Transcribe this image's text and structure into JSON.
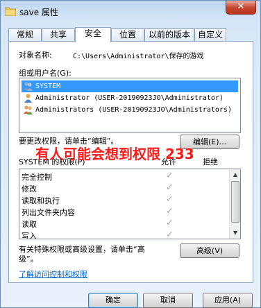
{
  "window": {
    "title": "save 属性",
    "close_label": "✕"
  },
  "tabs": [
    {
      "label": "常规"
    },
    {
      "label": "共享"
    },
    {
      "label": "安全"
    },
    {
      "label": "位置"
    },
    {
      "label": "以前的版本"
    },
    {
      "label": "自定义"
    }
  ],
  "security": {
    "object_name_label": "对象名称:",
    "object_name_value": "C:\\Users\\Administrator\\保存的游戏",
    "group_label": "组或用户名(G):",
    "users": [
      {
        "name": "SYSTEM"
      },
      {
        "name": "Administrator (USER-20190923JO\\Administrator)"
      },
      {
        "name": "Administrators (USER-20190923JO\\Administrators)"
      }
    ],
    "change_perm_text": "要更改权限，请单击“编辑”。",
    "edit_button": "编辑(E)...",
    "perm_header": "SYSTEM 的权限(P)",
    "allow_header": "允许",
    "deny_header": "拒绝",
    "permissions": [
      {
        "name": "完全控制",
        "allow": "✓"
      },
      {
        "name": "修改",
        "allow": "✓"
      },
      {
        "name": "读取和执行",
        "allow": "✓"
      },
      {
        "name": "列出文件夹内容",
        "allow": "✓"
      },
      {
        "name": "读取",
        "allow": "✓"
      },
      {
        "name": "写入",
        "allow": "✓"
      }
    ],
    "advanced_text_1": "有关特殊权限或高级设置，请单击“高",
    "advanced_text_2": "级”。",
    "advanced_button": "高级(V)",
    "learn_link": "了解访问控制和权限"
  },
  "overlay_text": "有人可能会想到权限 233",
  "footer": {
    "ok": "确定",
    "cancel": "取消",
    "apply": "应用(A)"
  }
}
